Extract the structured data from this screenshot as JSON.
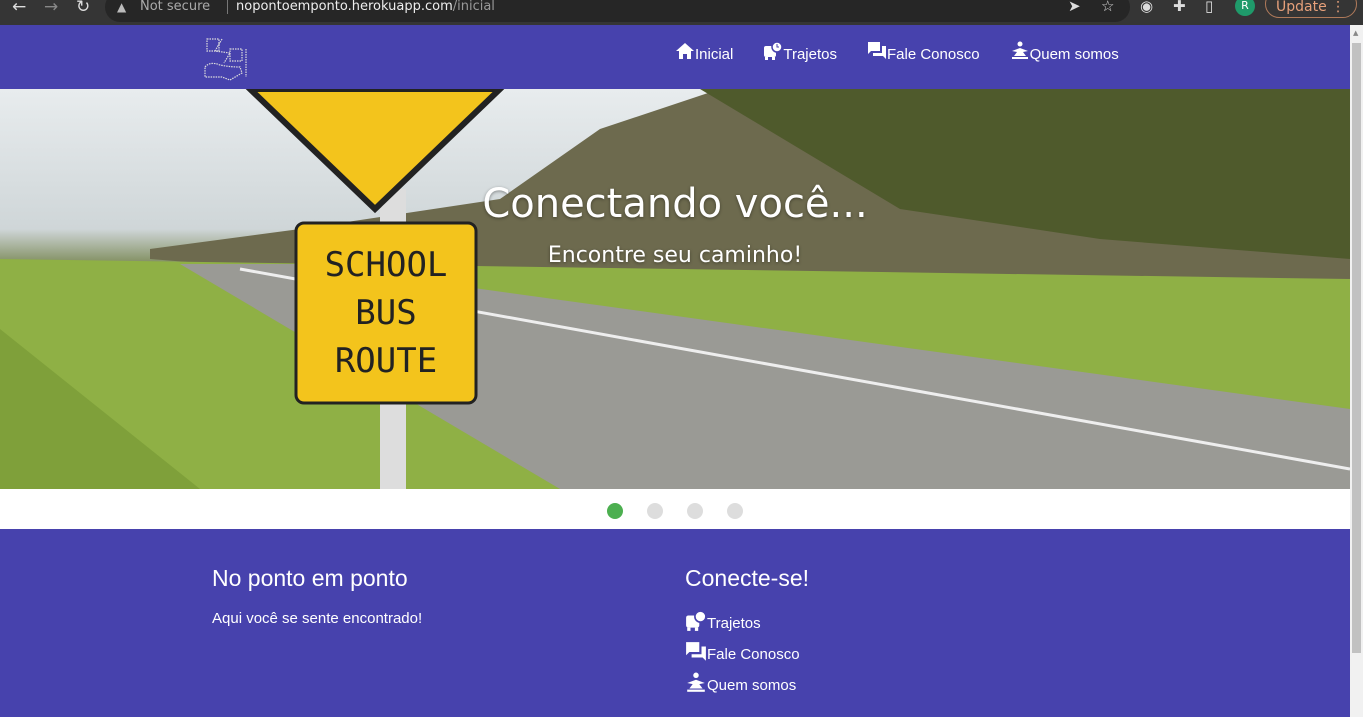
{
  "browser": {
    "security": "Not secure",
    "url_host": "nopontoemponto.herokuapp.com",
    "url_path": "/inicial",
    "profile_initial": "R",
    "update_label": "Update"
  },
  "nav": {
    "items": [
      {
        "label": "Inicial",
        "icon": "home-icon"
      },
      {
        "label": "Trajetos",
        "icon": "bus-clock-icon"
      },
      {
        "label": "Fale Conosco",
        "icon": "chat-icon"
      },
      {
        "label": "Quem somos",
        "icon": "person-icon"
      }
    ]
  },
  "hero": {
    "title": "Conectando você...",
    "subtitle": "Encontre seu caminho!",
    "sign": [
      "SCHOOL",
      "BUS",
      "ROUTE"
    ],
    "active_slide": 1,
    "slide_count": 4
  },
  "footer": {
    "about_title": "No ponto em ponto",
    "about_text": "Aqui você se sente encontrado!",
    "connect_title": "Conecte-se!",
    "links": [
      "Trajetos",
      "Fale Conosco",
      "Quem somos"
    ]
  },
  "colors": {
    "brand": "#4742ad",
    "active_dot": "#4caf50"
  }
}
